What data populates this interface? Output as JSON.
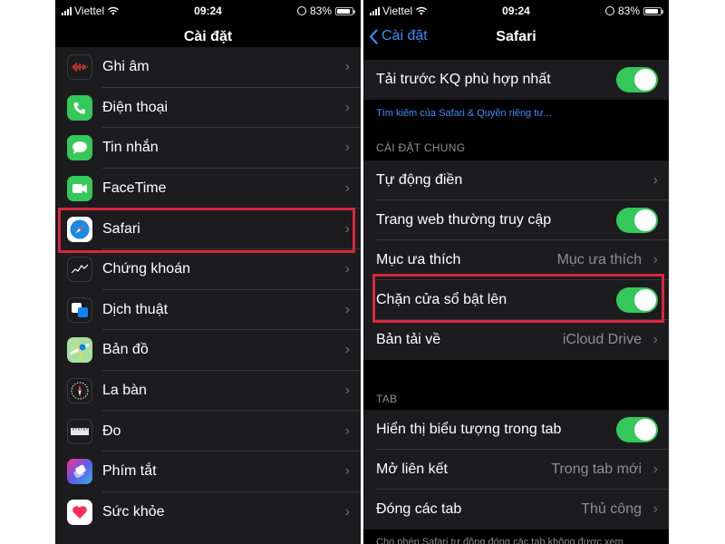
{
  "status": {
    "carrier": "Viettel",
    "time": "09:24",
    "battery": "83%",
    "battery_level": 0.83
  },
  "left": {
    "title": "Cài đặt",
    "items": [
      {
        "label": "Ghi âm",
        "icon": "voice-memos-icon",
        "color": "#1c1c1e"
      },
      {
        "label": "Điện thoại",
        "icon": "phone-icon",
        "color": "#34c759"
      },
      {
        "label": "Tin nhắn",
        "icon": "messages-icon",
        "color": "#34c759"
      },
      {
        "label": "FaceTime",
        "icon": "facetime-icon",
        "color": "#34c759"
      },
      {
        "label": "Safari",
        "icon": "safari-icon",
        "color": "#ffffff"
      },
      {
        "label": "Chứng khoán",
        "icon": "stocks-icon",
        "color": "#1c1c1e"
      },
      {
        "label": "Dịch thuật",
        "icon": "translate-icon",
        "color": "#1c1c1e"
      },
      {
        "label": "Bản đồ",
        "icon": "maps-icon",
        "color": "#5ac8fa"
      },
      {
        "label": "La bàn",
        "icon": "compass-icon",
        "color": "#1c1c1e"
      },
      {
        "label": "Đo",
        "icon": "measure-icon",
        "color": "#1c1c1e"
      },
      {
        "label": "Phím tắt",
        "icon": "shortcuts-icon",
        "color": "#5e5ce6"
      },
      {
        "label": "Sức khỏe",
        "icon": "health-icon",
        "color": "#ffffff"
      }
    ]
  },
  "right": {
    "back_label": "Cài đặt",
    "title": "Safari",
    "top_row": {
      "label": "Tải trước KQ phù hợp nhất",
      "toggle": true
    },
    "link": "Tìm kiếm của Safari & Quyền riêng tư...",
    "section_general": "CÀI ĐẶT CHUNG",
    "general": [
      {
        "label": "Tự động điền",
        "type": "chevron"
      },
      {
        "label": "Trang web thường truy cập",
        "type": "toggle"
      },
      {
        "label": "Mục ưa thích",
        "type": "value",
        "value": "Mục ưa thích"
      },
      {
        "label": "Chặn cửa sổ bật lên",
        "type": "toggle"
      },
      {
        "label": "Bản tải về",
        "type": "value",
        "value": "iCloud Drive"
      }
    ],
    "section_tab": "TAB",
    "tab": [
      {
        "label": "Hiển thị biểu tượng trong tab",
        "type": "toggle"
      },
      {
        "label": "Mở liên kết",
        "type": "value",
        "value": "Trong tab mới"
      },
      {
        "label": "Đóng các tab",
        "type": "value",
        "value": "Thủ công"
      }
    ],
    "footer": "Cho phép Safari tự động đóng các tab không được xem"
  },
  "colors": {
    "accent": "#3b8ef5",
    "toggle_on": "#34c759",
    "highlight": "#d7263d"
  }
}
